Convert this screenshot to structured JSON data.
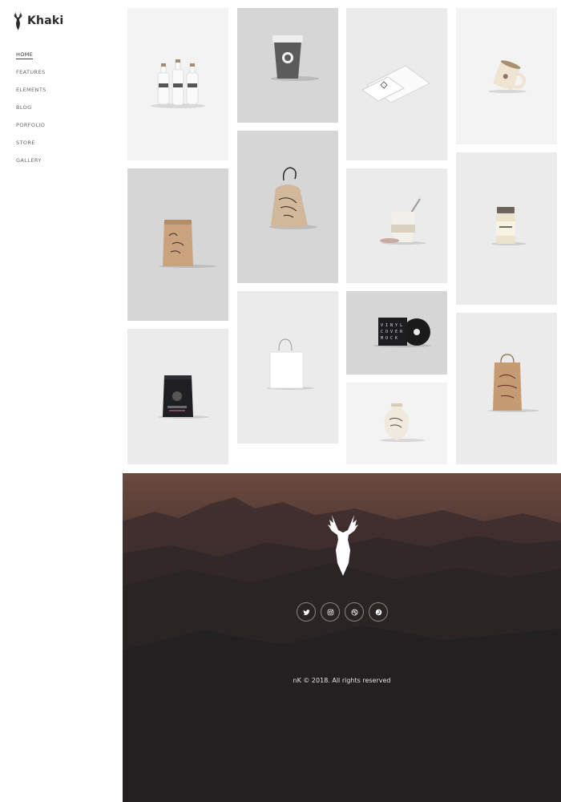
{
  "brand": {
    "name": "Khaki"
  },
  "nav": {
    "items": [
      {
        "label": "HOME",
        "active": true
      },
      {
        "label": "FEATURES"
      },
      {
        "label": "ELEMENTS"
      },
      {
        "label": "BLOG"
      },
      {
        "label": "PORFOLIO"
      },
      {
        "label": "STORE"
      },
      {
        "label": "GALLERY"
      }
    ]
  },
  "gallery": {
    "items": [
      {
        "subject": "milk-bottles"
      },
      {
        "subject": "coffee-cup"
      },
      {
        "subject": "business-cards"
      },
      {
        "subject": "enamel-mug"
      },
      {
        "subject": "paper-pouch"
      },
      {
        "subject": "drawstring-bag"
      },
      {
        "subject": "cup-with-straw"
      },
      {
        "subject": "glass-jar"
      },
      {
        "subject": "coffee-bag"
      },
      {
        "subject": "shopping-bag"
      },
      {
        "subject": "vinyl-record"
      },
      {
        "subject": "ceramic-vase"
      },
      {
        "subject": "kraft-bag"
      }
    ]
  },
  "footer": {
    "social": [
      {
        "icon": "twitter-icon"
      },
      {
        "icon": "instagram-icon"
      },
      {
        "icon": "dribbble-icon"
      },
      {
        "icon": "pinterest-icon"
      }
    ],
    "copyright": "nK © 2018. All rights reserved"
  },
  "colors": {
    "footer_top": "#6b4a3f",
    "footer_bottom": "#201e1f",
    "tile_light": "#f2f2f2",
    "tile_mid": "#d6d6d6"
  }
}
